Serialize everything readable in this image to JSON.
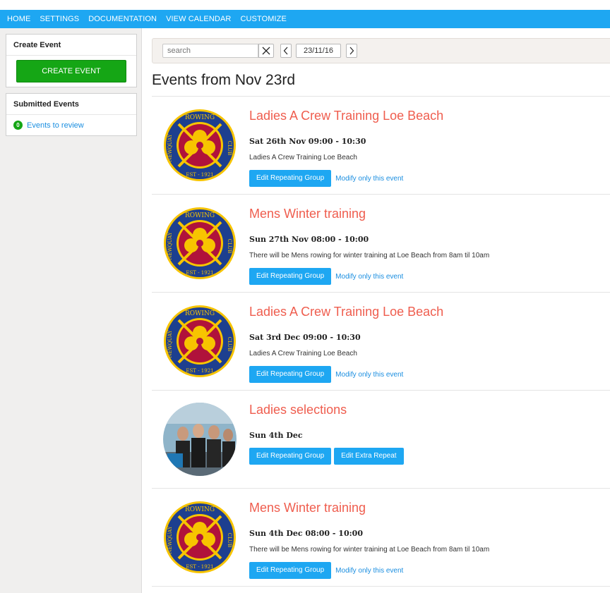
{
  "nav": {
    "items": [
      "HOME",
      "SETTINGS",
      "DOCUMENTATION",
      "VIEW CALENDAR",
      "CUSTOMIZE"
    ],
    "color": "#1ea7f2"
  },
  "sidebar": {
    "create_panel": {
      "title": "Create Event",
      "button_label": "CREATE EVENT"
    },
    "submitted_panel": {
      "title": "Submitted Events",
      "badge_count": "0",
      "link_label": "Events to review"
    }
  },
  "toolbar": {
    "search_placeholder": "search",
    "close_icon": "close-icon",
    "prev_icon": "chevron-left-icon",
    "date_value": "23/11/16",
    "next_icon": "chevron-right-icon"
  },
  "main": {
    "title": "Events from Nov 23rd"
  },
  "events": [
    {
      "title": "Ladies A Crew Training Loe Beach",
      "date": "Sat 26th Nov 09:00 - 10:30",
      "description": "Ladies A Crew Training Loe Beach",
      "image": "club-logo",
      "primary_button": "Edit Repeating Group",
      "secondary_button": "",
      "secondary_link": "Modify only this event"
    },
    {
      "title": "Mens Winter training",
      "date": "Sun 27th Nov 08:00 - 10:00",
      "description": "There will be Mens rowing for winter training at Loe Beach from 8am til 10am",
      "image": "club-logo",
      "primary_button": "Edit Repeating Group",
      "secondary_button": "",
      "secondary_link": "Modify only this event"
    },
    {
      "title": "Ladies A Crew Training Loe Beach",
      "date": "Sat 3rd Dec 09:00 - 10:30",
      "description": "Ladies A Crew Training Loe Beach",
      "image": "club-logo",
      "primary_button": "Edit Repeating Group",
      "secondary_button": "",
      "secondary_link": "Modify only this event"
    },
    {
      "title": "Ladies selections",
      "date": "Sun 4th Dec",
      "description": "",
      "image": "group-photo",
      "primary_button": "Edit Repeating Group",
      "secondary_button": "Edit Extra Repeat",
      "secondary_link": ""
    },
    {
      "title": "Mens Winter training",
      "date": "Sun 4th Dec 08:00 - 10:00",
      "description": "There will be Mens rowing for winter training at Loe Beach from 8am til 10am",
      "image": "club-logo",
      "primary_button": "Edit Repeating Group",
      "secondary_button": "",
      "secondary_link": "Modify only this event"
    }
  ]
}
